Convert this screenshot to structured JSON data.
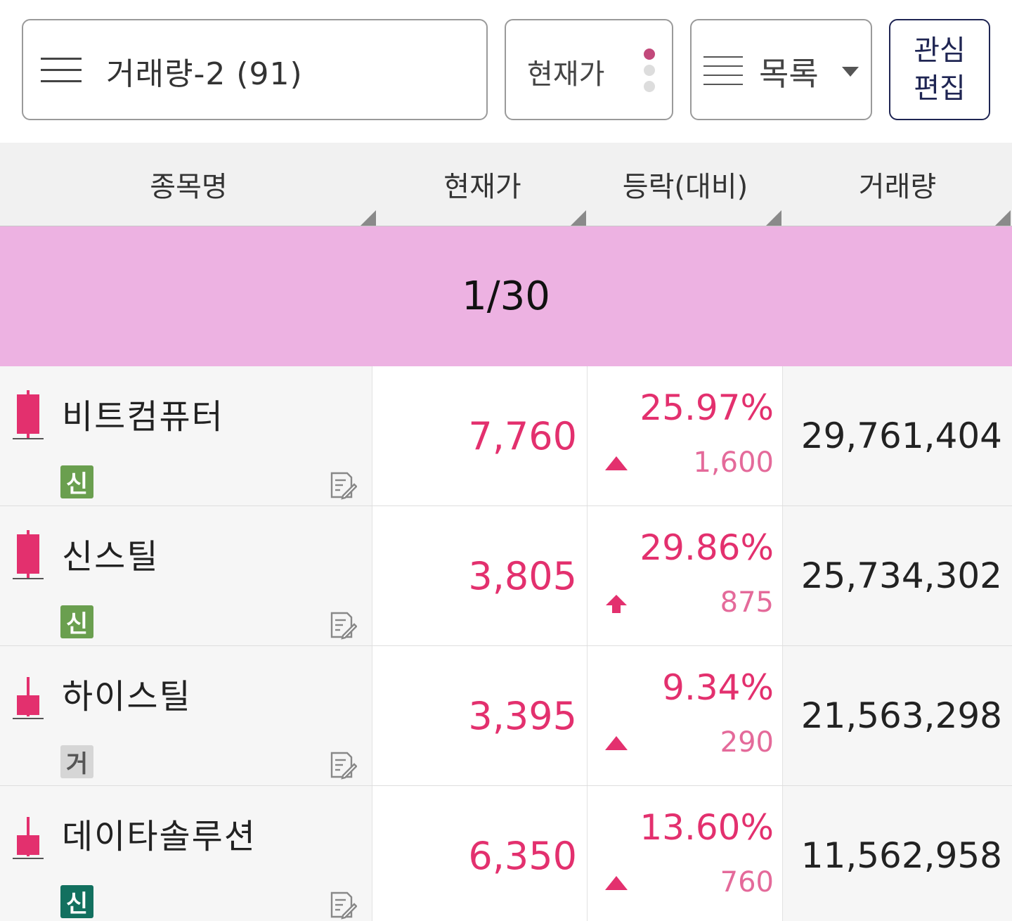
{
  "toolbar": {
    "filter_label": "거래량-2 (91)",
    "price_label": "현재가",
    "view_label": "목록",
    "edit_line1": "관심",
    "edit_line2": "편집"
  },
  "columns": {
    "name": "종목명",
    "price": "현재가",
    "change": "등락(대비)",
    "volume": "거래량"
  },
  "banner": {
    "text": "1/30"
  },
  "colors": {
    "up": "#e3306e",
    "banner": "#edb2e2",
    "badge_green": "#6a9f4f",
    "badge_teal": "#12705f",
    "badge_gray": "#d6d6d6"
  },
  "rows": [
    {
      "name": "비트컴퓨터",
      "badge": "신",
      "badge_style": "green",
      "price": "7,760",
      "change_pct": "25.97%",
      "change_amt": "1,600",
      "arrow": "up",
      "volume": "29,761,404",
      "candle": "full"
    },
    {
      "name": "신스틸",
      "badge": "신",
      "badge_style": "green",
      "price": "3,805",
      "change_pct": "29.86%",
      "change_amt": "875",
      "arrow": "limit-up",
      "volume": "25,734,302",
      "candle": "full"
    },
    {
      "name": "하이스틸",
      "badge": "거",
      "badge_style": "gray",
      "price": "3,395",
      "change_pct": "9.34%",
      "change_amt": "290",
      "arrow": "up",
      "volume": "21,563,298",
      "candle": "short"
    },
    {
      "name": "데이타솔루션",
      "badge": "신",
      "badge_style": "teal",
      "price": "6,350",
      "change_pct": "13.60%",
      "change_amt": "760",
      "arrow": "up",
      "volume": "11,562,958",
      "candle": "short"
    }
  ]
}
